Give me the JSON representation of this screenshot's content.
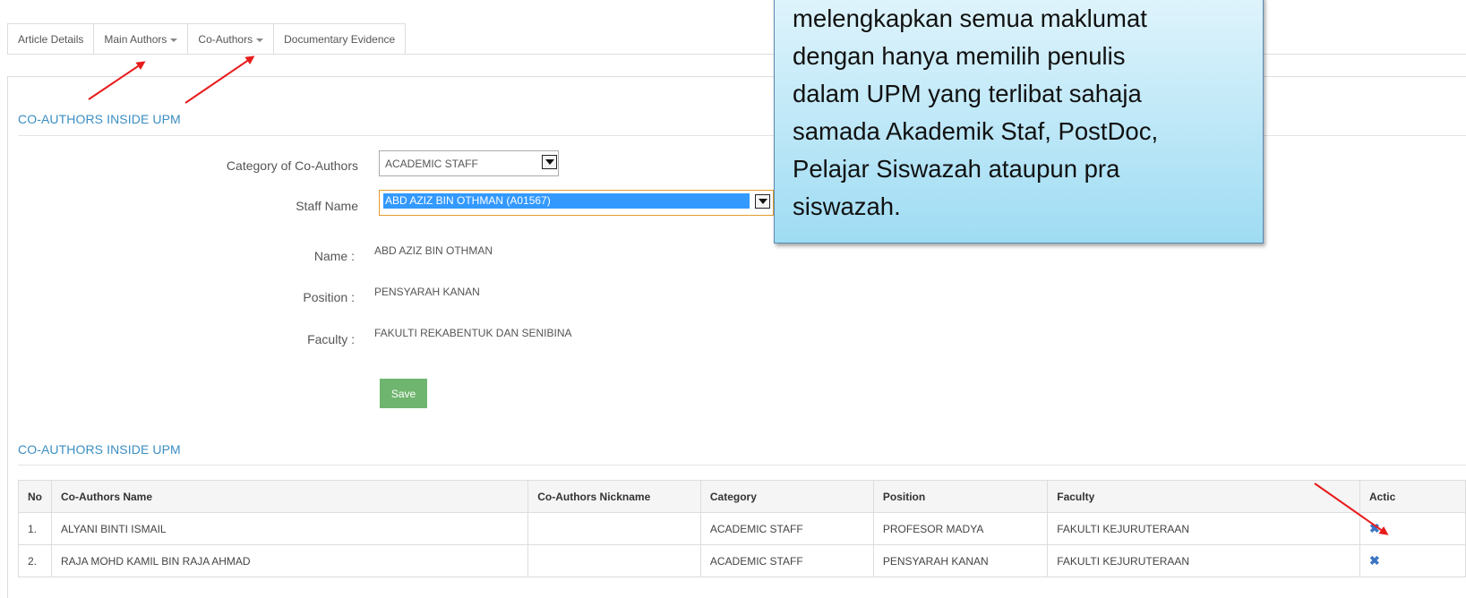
{
  "tabs": [
    {
      "label": "Article Details",
      "has_caret": false
    },
    {
      "label": "Main Authors",
      "has_caret": true
    },
    {
      "label": "Co-Authors",
      "has_caret": true
    },
    {
      "label": "Documentary Evidence",
      "has_caret": false
    }
  ],
  "form_section_title": "CO-AUTHORS INSIDE UPM",
  "form": {
    "category_label": "Category of Co-Authors",
    "category_value": "ACADEMIC STAFF",
    "staff_label": "Staff Name",
    "staff_value": "ABD AZIZ BIN OTHMAN (A01567)",
    "name_label": "Name :",
    "name_value": "ABD AZIZ BIN OTHMAN",
    "position_label": "Position :",
    "position_value": "PENSYARAH KANAN",
    "faculty_label": "Faculty :",
    "faculty_value": "FAKULTI REKABENTUK DAN SENIBINA",
    "save_label": "Save"
  },
  "table_section_title": "CO-AUTHORS INSIDE UPM",
  "table": {
    "headers": [
      "No",
      "Co-Authors Name",
      "Co-Authors Nickname",
      "Category",
      "Position",
      "Faculty",
      "Actic"
    ],
    "rows": [
      {
        "no": "1.",
        "name": "ALYANI BINTI ISMAIL",
        "nickname": "",
        "category": "ACADEMIC STAFF",
        "position": "PROFESOR MADYA",
        "faculty": "FAKULTI KEJURUTERAAN",
        "action_icon": "✖"
      },
      {
        "no": "2.",
        "name": "RAJA MOHD KAMIL BIN RAJA AHMAD",
        "nickname": "",
        "category": "ACADEMIC STAFF",
        "position": "PENSYARAH KANAN",
        "faculty": "FAKULTI KEJURUTERAAN",
        "action_icon": "✖"
      }
    ]
  },
  "callout": {
    "lines": [
      "melengkapkan semua maklumat",
      "dengan hanya memilih penulis",
      "dalam UPM yang terlibat sahaja",
      "samada Akademik Staf, PostDoc,",
      "Pelajar Siswazah ataupun pra",
      "siswazah."
    ]
  },
  "colors": {
    "section_title": "#3b8ec2",
    "save_button": "#6fb56f",
    "selection_highlight": "#3399ff",
    "annotation_arrow": "#e81c1c",
    "delete_icon": "#3a74c4"
  }
}
